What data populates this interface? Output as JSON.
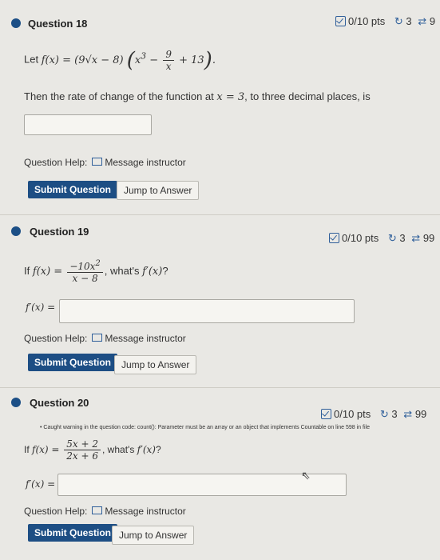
{
  "questions": [
    {
      "title": "Question 18",
      "score": "0/10 pts",
      "retries": "3",
      "attempts": "9",
      "prompt_prefix": "Let",
      "prompt_text": "Then the rate of change of the function at",
      "prompt_point": "x = 3",
      "prompt_suffix": ", to three decimal places, is",
      "help_label": "Question Help:",
      "message_label": "Message instructor",
      "submit_label": "Submit Question",
      "jump_label": "Jump to Answer"
    },
    {
      "title": "Question 19",
      "score": "0/10 pts",
      "retries": "3",
      "attempts": "99",
      "prompt_prefix": "If",
      "prompt_suffix": ", what's",
      "answer_label": "f′(x) =",
      "help_label": "Question Help:",
      "message_label": "Message instructor",
      "submit_label": "Submit Question",
      "jump_label": "Jump to Answer"
    },
    {
      "title": "Question 20",
      "score": "0/10 pts",
      "retries": "3",
      "attempts": "99",
      "warning": "Caught warning in the question code: count(): Parameter must be an array or an object that implements Countable on line 598 in file",
      "prompt_prefix": "If",
      "prompt_suffix": ", what's",
      "answer_label": "f′(x) =",
      "help_label": "Question Help:",
      "message_label": "Message instructor",
      "submit_label": "Submit Question",
      "jump_label": "Jump to Answer"
    }
  ]
}
